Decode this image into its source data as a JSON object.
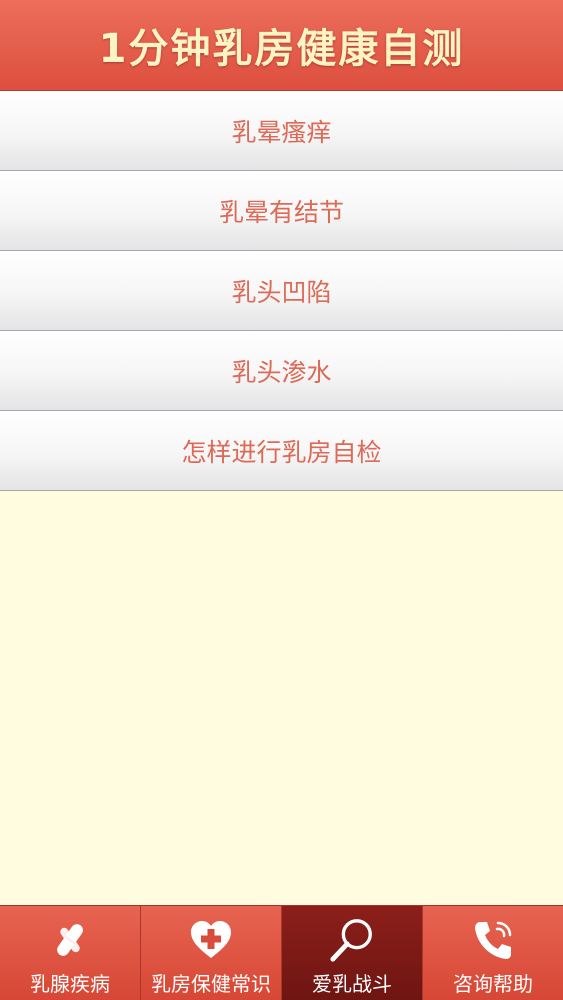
{
  "header": {
    "title": "1分钟乳房健康自测"
  },
  "menu": {
    "items": [
      {
        "label": "乳晕瘙痒"
      },
      {
        "label": "乳晕有结节"
      },
      {
        "label": "乳头凹陷"
      },
      {
        "label": "乳头渗水"
      },
      {
        "label": "怎样进行乳房自检"
      }
    ]
  },
  "tabbar": {
    "tabs": [
      {
        "label": "乳腺疾病",
        "icon": "pills-icon"
      },
      {
        "label": "乳房保健常识",
        "icon": "heart-plus-icon"
      },
      {
        "label": "爱乳战斗",
        "icon": "magnifier-icon",
        "active": true
      },
      {
        "label": "咨询帮助",
        "icon": "phone-icon"
      }
    ]
  },
  "colors": {
    "header_bg": "#e25a47",
    "header_text": "#fdf4c4",
    "item_text": "#dd6a57",
    "content_bg": "#fffce0",
    "tab_active": "#7d1a16"
  }
}
